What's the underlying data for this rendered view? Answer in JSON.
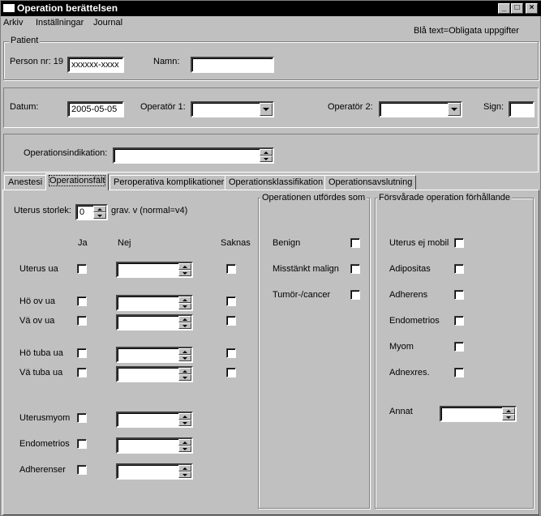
{
  "window": {
    "title": "Operation berättelsen"
  },
  "menu": [
    "Arkiv",
    "Inställningar",
    "Journal"
  ],
  "hint": "Blå text=Obligata uppgifter",
  "patient": {
    "legend": "Patient",
    "person_label": "Person nr: 19",
    "person_value": "xxxxxx-xxxx",
    "name_label": "Namn:",
    "name_value": ""
  },
  "header": {
    "date_label": "Datum:",
    "date_value": "2005-05-05",
    "op1_label": "Operatör 1:",
    "op1_value": "",
    "op2_label": "Operatör 2:",
    "op2_value": "",
    "sign_label": "Sign:",
    "sign_value": ""
  },
  "indication": {
    "label": "Operationsindikation:",
    "value": ""
  },
  "tabs": [
    "Anestesi",
    "Operationsfält",
    "Peroperativa komplikationer",
    "Operationsklassifikation",
    "Operationsavslutning"
  ],
  "active_tab": 1,
  "left": {
    "uterus_label": "Uterus storlek:",
    "uterus_value": "0",
    "uterus_suffix": "grav. v  (normal=v4)",
    "col_ja": "Ja",
    "col_nej": "Nej",
    "col_saknas": "Saknas",
    "rows": [
      "Uterus ua",
      "Hö ov ua",
      "Vä ov ua",
      "Hö tuba ua",
      "Vä tuba ua",
      "Uterusmyom",
      "Endometrios",
      "Adherenser"
    ]
  },
  "middle": {
    "legend": "Operationen utfördes som",
    "rows": [
      "Benign",
      "Misstänkt malign",
      "Tumör-/cancer"
    ]
  },
  "right": {
    "legend": "Försvårade operation förhållande",
    "rows": [
      "Uterus ej mobil",
      "Adipositas",
      "Adherens",
      "Endometrios",
      "Myom",
      "Adnexres."
    ],
    "other_label": "Annat",
    "other_value": ""
  }
}
